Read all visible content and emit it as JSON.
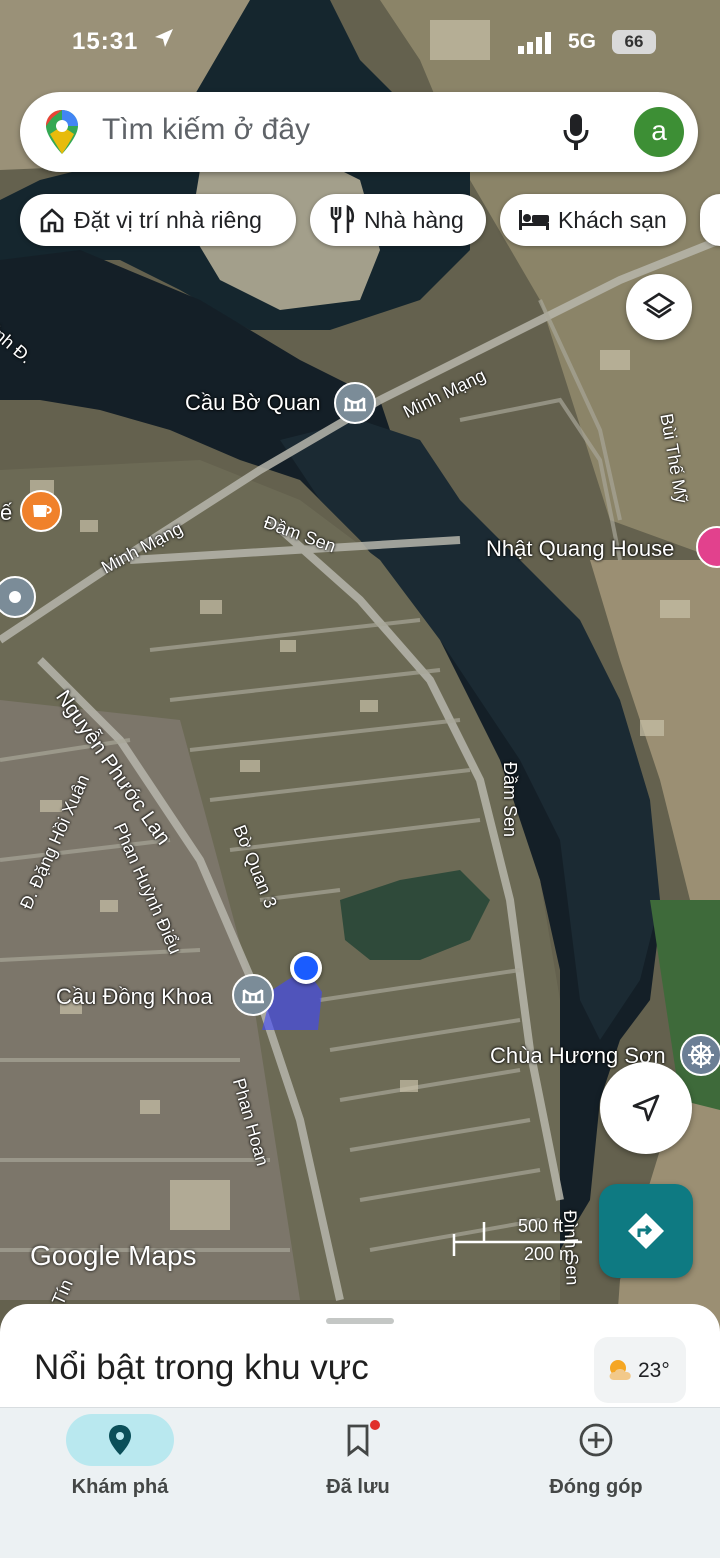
{
  "status_bar": {
    "time": "15:31",
    "network": "5G",
    "battery": "66"
  },
  "search": {
    "placeholder": "Tìm kiếm ở đây",
    "avatar_letter": "a"
  },
  "chips": [
    {
      "label": "Đặt vị trí nhà riêng",
      "icon": "home-icon"
    },
    {
      "label": "Nhà hàng",
      "icon": "restaurant-icon"
    },
    {
      "label": "Khách sạn",
      "icon": "hotel-icon"
    }
  ],
  "map_labels": {
    "bridge_bo_quan": "Cầu Bờ Quan",
    "bridge_dong_khoa": "Cầu Đồng Khoa",
    "hotel_nhat_quang": "Nhật Quang House",
    "pagoda": "Chùa Hương Sơn",
    "cafe_partial": "ế"
  },
  "road_labels": {
    "minh_mang_1": "Minh Mạng",
    "minh_mang_2": "Minh Mạng",
    "dam_sen_1": "Đầm Sen",
    "dam_sen_2": "Đầm Sen",
    "nguyen_phuoc_lan": "Nguyễn Phước Lan",
    "bo_quan_3": "Bờ Quan 3",
    "phan_huynh_dieu": "Phan Huỳnh Điểu",
    "dang_hoi_xuan": "Đ. Đặng Hồi Xuân",
    "phan_hoan": "Phan Hoan",
    "bui_the_my": "Bùi Thế Mỹ",
    "dinh_sen": "Đình Sen",
    "minh_d": "inh Đ.",
    "tin": "Tín"
  },
  "watermark": "Google Maps",
  "scale": {
    "top": "500 ft",
    "bottom": "200 m"
  },
  "sheet": {
    "title": "Nổi bật trong khu vực"
  },
  "weather": {
    "temp": "23°"
  },
  "bottom_nav": [
    {
      "label": "Khám phá",
      "active": true
    },
    {
      "label": "Đã lưu",
      "active": false
    },
    {
      "label": "Đóng góp",
      "active": false
    }
  ],
  "colors": {
    "accent": "#0e7a82",
    "nav_active_pill": "#b9e8ef",
    "location_dot": "#1a5cff"
  }
}
